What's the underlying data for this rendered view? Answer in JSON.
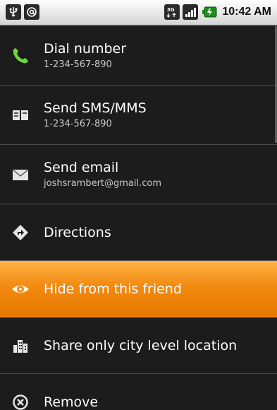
{
  "status_bar": {
    "left_icons": [
      "usb-icon",
      "at-icon"
    ],
    "right_icons": [
      "network-3g-icon",
      "signal-icon",
      "battery-icon"
    ],
    "time": "10:42 AM"
  },
  "menu": {
    "items": [
      {
        "label": "Dial number",
        "sub": "1-234-567-890",
        "icon": "phone-icon",
        "color": "#6fd63a"
      },
      {
        "label": "Send SMS/MMS",
        "sub": "1-234-567-890",
        "icon": "sms-icon"
      },
      {
        "label": "Send email",
        "sub": "joshsrambert@gmail.com",
        "icon": "envelope-icon"
      },
      {
        "label": "Directions",
        "icon": "directions-icon"
      },
      {
        "label": "Hide from this friend",
        "icon": "eye-icon",
        "selected": true
      },
      {
        "label": "Share only city level location",
        "icon": "city-icon"
      },
      {
        "label": "Remove",
        "icon": "remove-icon"
      }
    ]
  },
  "colors": {
    "highlight": "#f28a10",
    "background": "#1c1c1c"
  }
}
